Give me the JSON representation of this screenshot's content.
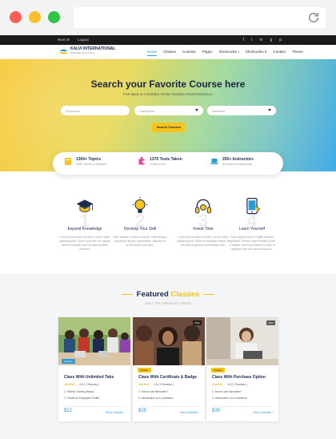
{
  "topbar": {
    "phone": "Rent W",
    "login": "Logout",
    "social": [
      "f",
      "t",
      "in",
      "g",
      "p"
    ]
  },
  "nav": {
    "logo_title": "KALVI INTERNATIONAL",
    "logo_sub": "Education at its Finest",
    "items": [
      "Home",
      "Classes",
      "Courses",
      "Pages",
      "Shortcodes I",
      "Shortcodes II",
      "Contact",
      "Theme"
    ],
    "active": "Home"
  },
  "hero": {
    "title": "Search your Favorite Course here",
    "subtitle": "FOR MAIN IN COURSES FROM TRAINED PROFESSIONALS",
    "fields": [
      {
        "placeholder": "Keywords",
        "dropdown": false
      },
      {
        "placeholder": "Categories",
        "dropdown": true
      },
      {
        "placeholder": "Instructor",
        "dropdown": true
      }
    ],
    "search_button": "Search Courses"
  },
  "stats": [
    {
      "title": "1300+ Topics",
      "desc": "Wide Choice of Subjects",
      "icon": "book-icon"
    },
    {
      "title": "1376 Tests Taken",
      "desc": "Create a test",
      "icon": "puzzle-icon"
    },
    {
      "title": "250+ Instructors",
      "desc": "All trained professionals",
      "icon": "laptop-icon"
    }
  ],
  "features": [
    {
      "number": "1",
      "title": "Expand Knowledge",
      "text": "Lorem ipsum dolor sit amet, conse ctetur adipiscing elit. Donec quis est non sapien laoreet ultricies nunc suscipit facilisis eleifend.",
      "icon": "graduation-cap-icon"
    },
    {
      "number": "2",
      "title": "Develop Your Skill",
      "text": "Nam efficitur tincidunt blandit. Pellentesque dignissim ultrices consectetur. Aliquam at eu elit dictum posuere.",
      "icon": "lightbulb-icon"
    },
    {
      "number": "3",
      "title": "Invest Time",
      "text": "Lorem ipsum dolor sit amet, conse ctetur adipiscing elit. Etiam at vulputate lectus. In vel tellus a gravida consectetur arcu.",
      "icon": "headphones-icon"
    },
    {
      "number": "4",
      "title": "Learn Yourself",
      "text": "Duis aliquet metus fringilla pretium dignissim. Aenean eget tincidunt justo. Curabitur vehicula pharetra in ante ut egestas velit nisi interdum ipsum.",
      "icon": "tablet-icon"
    }
  ],
  "featured": {
    "title": "Featured",
    "title_accent": "Classes",
    "subtitle": "ONLY THE GREATEST MINDS"
  },
  "cards": [
    {
      "title": "Class With Unlimited Tabs",
      "badge": "Classes",
      "badge_style": "blue",
      "video": "",
      "rating": "4.5 ( 2 Reviews )",
      "lessons": [
        "1. Fitness Training Basics",
        "2. Create an Employee Profile"
      ],
      "price": "$12",
      "details": "View Details"
    },
    {
      "title": "Class With Certificate & Badge",
      "badge": "Classes",
      "badge_style": "yellow",
      "video": "Video",
      "rating": "4.5 ( 2 Reviews )",
      "lessons": [
        "1. How to use Barcodes?",
        "2. Introduction to e-commerce"
      ],
      "price": "$25",
      "details": "View Details"
    },
    {
      "title": "Class With Purchase Option",
      "badge": "Classes",
      "badge_style": "yellow",
      "video": "Video",
      "rating": "4.5 ( 2 Reviews )",
      "lessons": [
        "1. How to use Barcodes?",
        "2. Introduction to e-commerce"
      ],
      "price": "$30",
      "details": "View Details"
    }
  ],
  "colors": {
    "accent_yellow": "#f7c41b",
    "accent_blue": "#2b9bd6",
    "heading": "#1d2b4f"
  }
}
